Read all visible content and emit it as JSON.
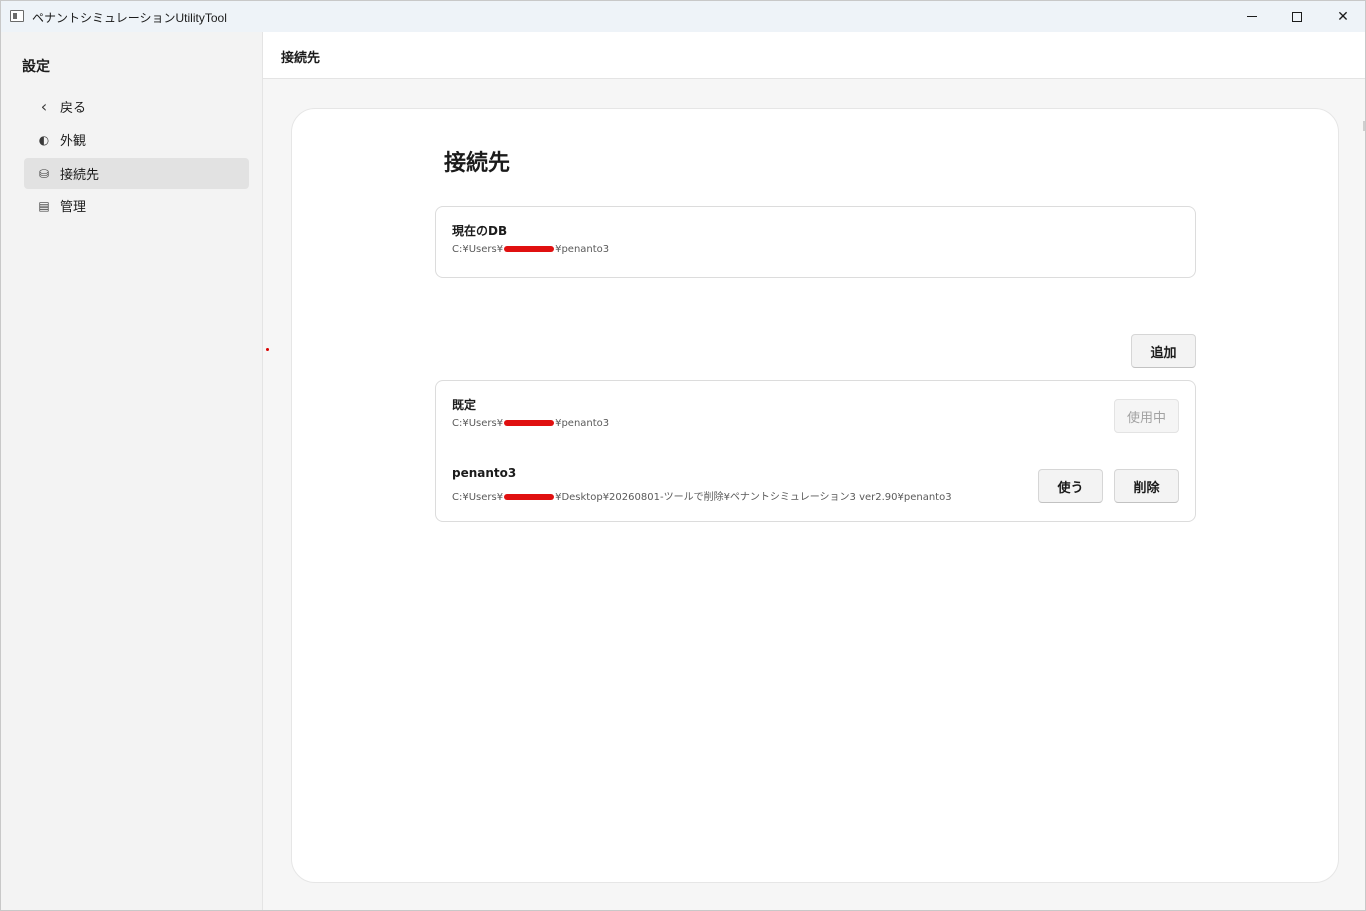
{
  "window": {
    "title": "ペナントシミュレーションUtilityTool",
    "minimize": "minimize",
    "maximize": "maximize",
    "close": "✕"
  },
  "sidebar": {
    "title": "設定",
    "items": [
      {
        "label": "戻る",
        "icon": "chevron-left-icon",
        "glyph": "‹"
      },
      {
        "label": "外観",
        "icon": "appearance-icon",
        "glyph": "◐"
      },
      {
        "label": "接続先",
        "icon": "database-icon",
        "glyph": "⛁"
      },
      {
        "label": "管理",
        "icon": "management-icon",
        "glyph": "▤"
      }
    ],
    "selected": "接続先"
  },
  "header": {
    "title": "接続先"
  },
  "main": {
    "page_title": "接続先",
    "current_db": {
      "name": "現在のDB",
      "path_prefix": "C:¥Users¥",
      "path_suffix": "¥penanto3"
    },
    "add_button": "追加",
    "connections": [
      {
        "name": "既定",
        "path_prefix": "C:¥Users¥",
        "path_suffix": "¥penanto3",
        "status_button": "使用中"
      },
      {
        "name": "penanto3",
        "path_prefix": "C:¥Users¥",
        "path_suffix": "¥Desktop¥20260801-ツールで削除¥ペナントシミュレーション3 ver2.90¥penanto3",
        "use_button": "使う",
        "delete_button": "削除"
      }
    ]
  },
  "colors": {
    "redaction": "#e01010",
    "selected_nav": "#e2e2e2",
    "panel": "#ffffff"
  }
}
